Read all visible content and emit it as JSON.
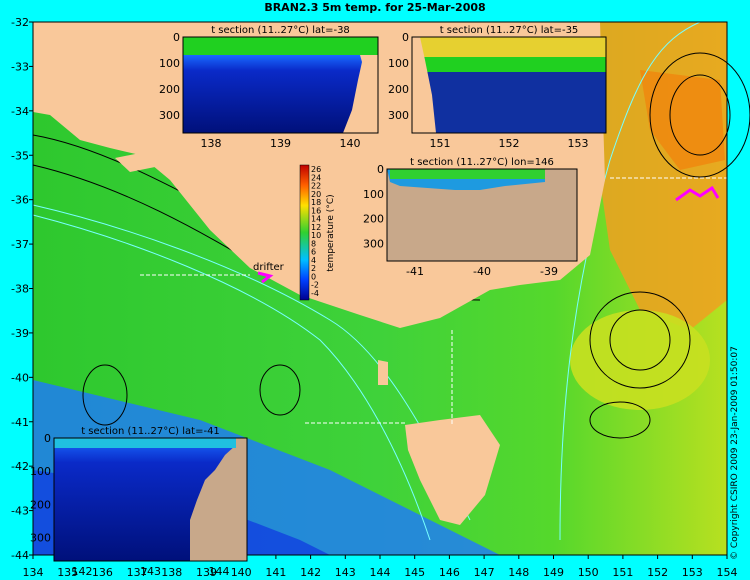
{
  "title": "BRAN2.3 5m temp. for 25-Mar-2008",
  "copyright": "© Copyright CSIRO 2009   23-Jan-2009 01:50:07",
  "map": {
    "x_ticks": [
      "134",
      "135",
      "136",
      "137",
      "138",
      "139",
      "140",
      "141",
      "142",
      "143",
      "144",
      "145",
      "146",
      "147",
      "148",
      "149",
      "150",
      "151",
      "152",
      "153",
      "154"
    ],
    "y_ticks": [
      "-32",
      "-33",
      "-34",
      "-35",
      "-36",
      "-37",
      "-38",
      "-39",
      "-40",
      "-41",
      "-42",
      "-43",
      "-44"
    ],
    "drifter_label": "drifter",
    "colors": {
      "land": "#f9c89a",
      "ocean_mid": "#32c832",
      "background": "#00ffff",
      "drifter": "#ff00ff"
    }
  },
  "colorbar": {
    "label": "temperature (°C)",
    "ticks": [
      "26",
      "24",
      "22",
      "20",
      "18",
      "16",
      "14",
      "12",
      "10",
      "8",
      "6",
      "4",
      "2",
      "0",
      "-2",
      "-4"
    ]
  },
  "insets": [
    {
      "id": "lat-38",
      "title": "t section (11..27°C) lat=-38",
      "x_ticks": [
        "138",
        "139",
        "140"
      ],
      "y_ticks": [
        "0",
        "100",
        "200",
        "300"
      ]
    },
    {
      "id": "lat-35",
      "title": "t section (11..27°C) lat=-35",
      "x_ticks": [
        "151",
        "152",
        "153"
      ],
      "y_ticks": [
        "0",
        "100",
        "200",
        "300"
      ]
    },
    {
      "id": "lon146",
      "title": "t section (11..27°C) lon=146",
      "x_ticks": [
        "-41",
        "-40",
        "-39"
      ],
      "y_ticks": [
        "0",
        "100",
        "200",
        "300"
      ]
    },
    {
      "id": "lat-41",
      "title": "t section (11..27°C) lat=-41",
      "x_ticks": [
        "142",
        "143",
        "144"
      ],
      "y_ticks": [
        "0",
        "100",
        "200",
        "300"
      ]
    }
  ]
}
